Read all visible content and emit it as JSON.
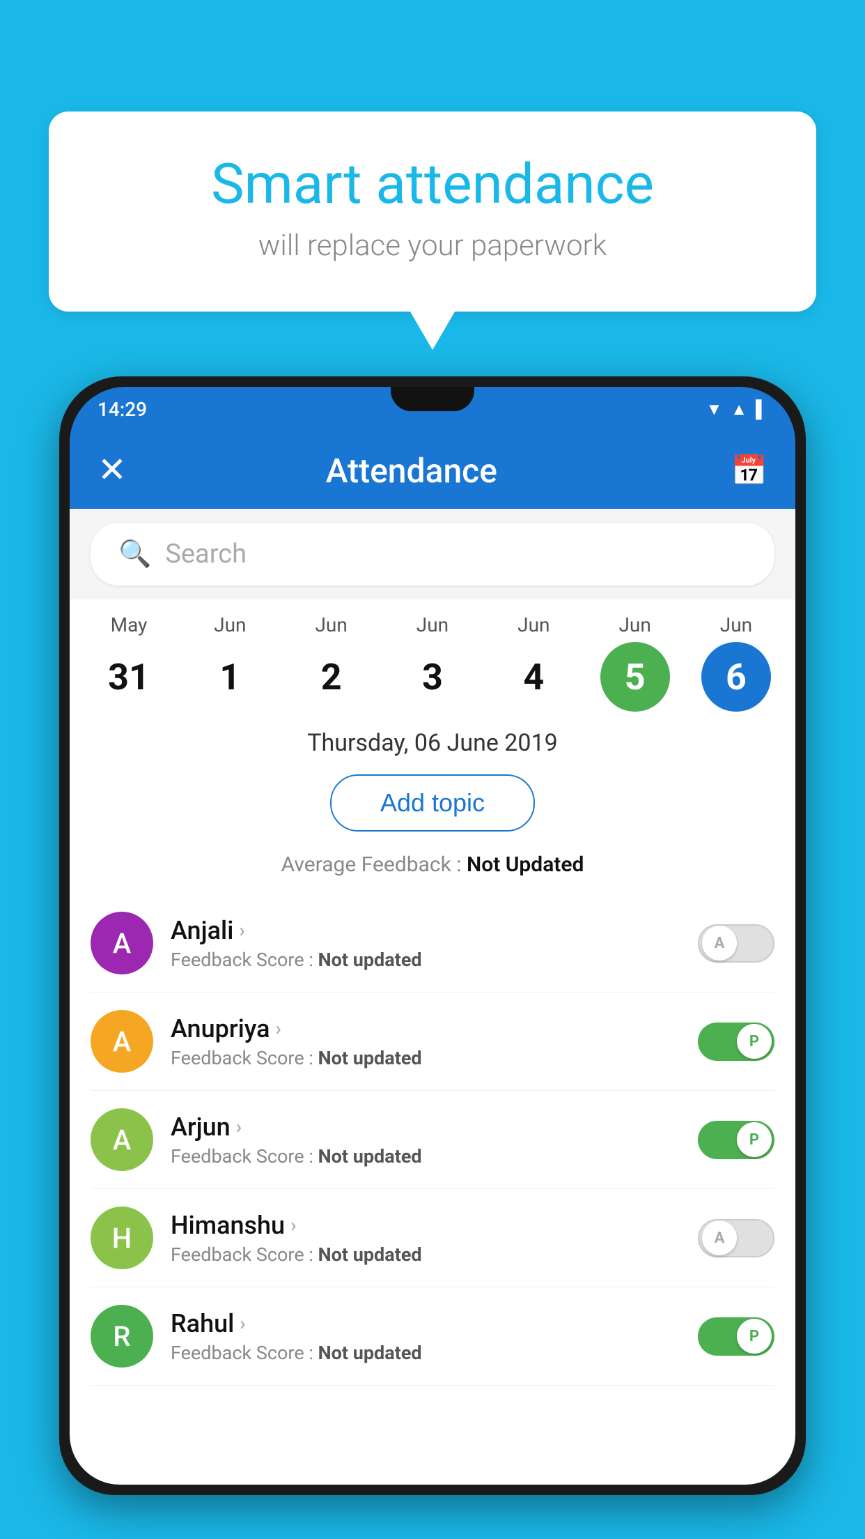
{
  "background_color": "#1ab8e8",
  "bubble": {
    "title": "Smart attendance",
    "subtitle": "will replace your paperwork"
  },
  "status_bar": {
    "time": "14:29",
    "icons": [
      "▼",
      "▲",
      "▌"
    ]
  },
  "app_bar": {
    "close_label": "✕",
    "title": "Attendance",
    "calendar_icon": "📅"
  },
  "search": {
    "placeholder": "Search"
  },
  "calendar": {
    "dates": [
      {
        "month": "May",
        "day": "31",
        "style": "normal"
      },
      {
        "month": "Jun",
        "day": "1",
        "style": "normal"
      },
      {
        "month": "Jun",
        "day": "2",
        "style": "normal"
      },
      {
        "month": "Jun",
        "day": "3",
        "style": "normal"
      },
      {
        "month": "Jun",
        "day": "4",
        "style": "normal"
      },
      {
        "month": "Jun",
        "day": "5",
        "style": "green"
      },
      {
        "month": "Jun",
        "day": "6",
        "style": "blue"
      }
    ],
    "selected_date": "Thursday, 06 June 2019"
  },
  "add_topic": {
    "label": "Add topic"
  },
  "feedback_summary": {
    "label": "Average Feedback : ",
    "value": "Not Updated"
  },
  "students": [
    {
      "name": "Anjali",
      "avatar_letter": "A",
      "avatar_color": "#9c27b0",
      "feedback": "Not updated",
      "toggle": "off",
      "toggle_letter": "A"
    },
    {
      "name": "Anupriya",
      "avatar_letter": "A",
      "avatar_color": "#f5a623",
      "feedback": "Not updated",
      "toggle": "on",
      "toggle_letter": "P"
    },
    {
      "name": "Arjun",
      "avatar_letter": "A",
      "avatar_color": "#8bc34a",
      "feedback": "Not updated",
      "toggle": "on",
      "toggle_letter": "P"
    },
    {
      "name": "Himanshu",
      "avatar_letter": "H",
      "avatar_color": "#8bc34a",
      "feedback": "Not updated",
      "toggle": "off",
      "toggle_letter": "A"
    },
    {
      "name": "Rahul",
      "avatar_letter": "R",
      "avatar_color": "#4caf50",
      "feedback": "Not updated",
      "toggle": "on",
      "toggle_letter": "P"
    }
  ],
  "labels": {
    "feedback_prefix": "Feedback Score : "
  }
}
